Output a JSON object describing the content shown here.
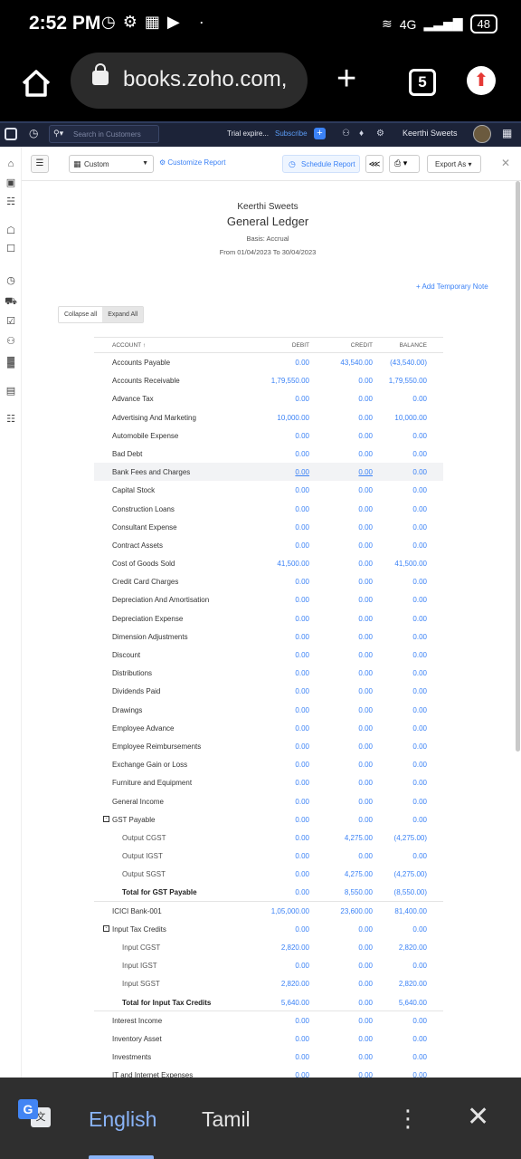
{
  "statusbar": {
    "time": "2:52 PM",
    "network": "4G",
    "battery": "48"
  },
  "browser": {
    "url": "books.zoho.com,",
    "tab_count": "5"
  },
  "app_header": {
    "search_placeholder": "Search in Customers",
    "trial_text": "Trial expire...",
    "subscribe_label": "Subscribe",
    "org_name": "Keerthi Sweets"
  },
  "toolbar": {
    "period": "Custom",
    "customize_label": "Customize Report",
    "schedule_label": "Schedule Report",
    "export_label": "Export As"
  },
  "report": {
    "org": "Keerthi Sweets",
    "title": "General Ledger",
    "basis": "Basis: Accrual",
    "range": "From 01/04/2023 To 30/04/2023",
    "add_note": "Add Temporary Note",
    "collapse_all": "Collapse all",
    "expand_all": "Expand All",
    "columns": {
      "account": "ACCOUNT",
      "debit": "DEBIT",
      "credit": "CREDIT",
      "balance": "BALANCE"
    },
    "rows": [
      {
        "account": "Accounts Payable",
        "debit": "0.00",
        "credit": "43,540.00",
        "balance": "(43,540.00)",
        "kind": "normal"
      },
      {
        "account": "Accounts Receivable",
        "debit": "1,79,550.00",
        "credit": "0.00",
        "balance": "1,79,550.00",
        "kind": "normal"
      },
      {
        "account": "Advance Tax",
        "debit": "0.00",
        "credit": "0.00",
        "balance": "0.00",
        "kind": "normal"
      },
      {
        "account": "Advertising And Marketing",
        "debit": "10,000.00",
        "credit": "0.00",
        "balance": "10,000.00",
        "kind": "normal"
      },
      {
        "account": "Automobile Expense",
        "debit": "0.00",
        "credit": "0.00",
        "balance": "0.00",
        "kind": "normal"
      },
      {
        "account": "Bad Debt",
        "debit": "0.00",
        "credit": "0.00",
        "balance": "0.00",
        "kind": "normal"
      },
      {
        "account": "Bank Fees and Charges",
        "debit": "0.00",
        "credit": "0.00",
        "balance": "0.00",
        "kind": "hl"
      },
      {
        "account": "Capital Stock",
        "debit": "0.00",
        "credit": "0.00",
        "balance": "0.00",
        "kind": "normal"
      },
      {
        "account": "Construction Loans",
        "debit": "0.00",
        "credit": "0.00",
        "balance": "0.00",
        "kind": "normal"
      },
      {
        "account": "Consultant Expense",
        "debit": "0.00",
        "credit": "0.00",
        "balance": "0.00",
        "kind": "normal"
      },
      {
        "account": "Contract Assets",
        "debit": "0.00",
        "credit": "0.00",
        "balance": "0.00",
        "kind": "normal"
      },
      {
        "account": "Cost of Goods Sold",
        "debit": "41,500.00",
        "credit": "0.00",
        "balance": "41,500.00",
        "kind": "normal"
      },
      {
        "account": "Credit Card Charges",
        "debit": "0.00",
        "credit": "0.00",
        "balance": "0.00",
        "kind": "normal"
      },
      {
        "account": "Depreciation And Amortisation",
        "debit": "0.00",
        "credit": "0.00",
        "balance": "0.00",
        "kind": "normal"
      },
      {
        "account": "Depreciation Expense",
        "debit": "0.00",
        "credit": "0.00",
        "balance": "0.00",
        "kind": "normal"
      },
      {
        "account": "Dimension Adjustments",
        "debit": "0.00",
        "credit": "0.00",
        "balance": "0.00",
        "kind": "normal"
      },
      {
        "account": "Discount",
        "debit": "0.00",
        "credit": "0.00",
        "balance": "0.00",
        "kind": "normal"
      },
      {
        "account": "Distributions",
        "debit": "0.00",
        "credit": "0.00",
        "balance": "0.00",
        "kind": "normal"
      },
      {
        "account": "Dividends Paid",
        "debit": "0.00",
        "credit": "0.00",
        "balance": "0.00",
        "kind": "normal"
      },
      {
        "account": "Drawings",
        "debit": "0.00",
        "credit": "0.00",
        "balance": "0.00",
        "kind": "normal"
      },
      {
        "account": "Employee Advance",
        "debit": "0.00",
        "credit": "0.00",
        "balance": "0.00",
        "kind": "normal"
      },
      {
        "account": "Employee Reimbursements",
        "debit": "0.00",
        "credit": "0.00",
        "balance": "0.00",
        "kind": "normal"
      },
      {
        "account": "Exchange Gain or Loss",
        "debit": "0.00",
        "credit": "0.00",
        "balance": "0.00",
        "kind": "normal"
      },
      {
        "account": "Furniture and Equipment",
        "debit": "0.00",
        "credit": "0.00",
        "balance": "0.00",
        "kind": "normal"
      },
      {
        "account": "General Income",
        "debit": "0.00",
        "credit": "0.00",
        "balance": "0.00",
        "kind": "normal"
      },
      {
        "account": "GST Payable",
        "debit": "0.00",
        "credit": "0.00",
        "balance": "0.00",
        "kind": "parent"
      },
      {
        "account": "Output CGST",
        "debit": "0.00",
        "credit": "4,275.00",
        "balance": "(4,275.00)",
        "kind": "child"
      },
      {
        "account": "Output IGST",
        "debit": "0.00",
        "credit": "0.00",
        "balance": "0.00",
        "kind": "child"
      },
      {
        "account": "Output SGST",
        "debit": "0.00",
        "credit": "4,275.00",
        "balance": "(4,275.00)",
        "kind": "child"
      },
      {
        "account": "Total for GST Payable",
        "debit": "0.00",
        "credit": "8,550.00",
        "balance": "(8,550.00)",
        "kind": "total"
      },
      {
        "account": "ICICI Bank-001",
        "debit": "1,05,000.00",
        "credit": "23,600.00",
        "balance": "81,400.00",
        "kind": "normal"
      },
      {
        "account": "Input Tax Credits",
        "debit": "0.00",
        "credit": "0.00",
        "balance": "0.00",
        "kind": "parent"
      },
      {
        "account": "Input CGST",
        "debit": "2,820.00",
        "credit": "0.00",
        "balance": "2,820.00",
        "kind": "child"
      },
      {
        "account": "Input IGST",
        "debit": "0.00",
        "credit": "0.00",
        "balance": "0.00",
        "kind": "child"
      },
      {
        "account": "Input SGST",
        "debit": "2,820.00",
        "credit": "0.00",
        "balance": "2,820.00",
        "kind": "child"
      },
      {
        "account": "Total for Input Tax Credits",
        "debit": "5,640.00",
        "credit": "0.00",
        "balance": "5,640.00",
        "kind": "total"
      },
      {
        "account": "Interest Income",
        "debit": "0.00",
        "credit": "0.00",
        "balance": "0.00",
        "kind": "normal"
      },
      {
        "account": "Inventory Asset",
        "debit": "0.00",
        "credit": "0.00",
        "balance": "0.00",
        "kind": "normal"
      },
      {
        "account": "Investments",
        "debit": "0.00",
        "credit": "0.00",
        "balance": "0.00",
        "kind": "normal"
      },
      {
        "account": "IT and Internet Expenses",
        "debit": "0.00",
        "credit": "0.00",
        "balance": "0.00",
        "kind": "normal"
      }
    ]
  },
  "translate_bar": {
    "lang_selected": "English",
    "lang_other": "Tamil"
  },
  "colors": {
    "link_blue": "#3b82f6",
    "header_navy": "#1c2338",
    "translate_blue": "#8ab4f8"
  }
}
